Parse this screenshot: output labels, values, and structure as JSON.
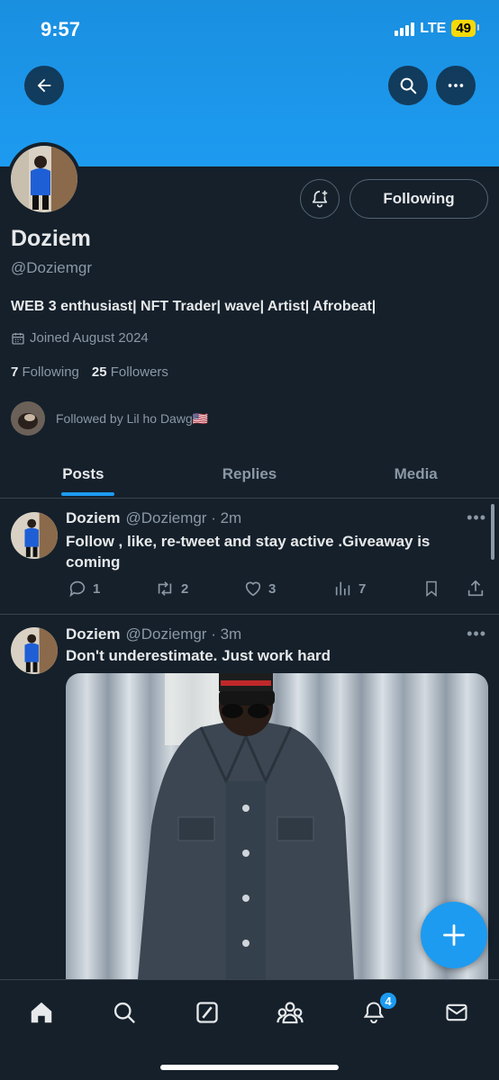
{
  "status_bar": {
    "time": "9:57",
    "network": "LTE",
    "battery": "49"
  },
  "header": {
    "back_icon": "arrow-left-icon",
    "search_icon": "search-icon",
    "more_icon": "more-horizontal-icon"
  },
  "profile": {
    "display_name": "Doziem",
    "handle": "@Doziemgr",
    "bio": "WEB 3 enthusiast| NFT Trader| wave| Artist| Afrobeat|",
    "joined": "Joined August 2024",
    "following_count": "7",
    "following_label": "Following",
    "followers_count": "25",
    "followers_label": "Followers",
    "followed_by": "Followed by Lil ho Dawg🇺🇸",
    "follow_button_label": "Following"
  },
  "tabs": [
    {
      "label": "Posts",
      "active": true
    },
    {
      "label": "Replies",
      "active": false
    },
    {
      "label": "Media",
      "active": false
    }
  ],
  "posts": [
    {
      "name": "Doziem",
      "meta": "@Doziemgr · 2m",
      "text": "Follow , like, re-tweet  and stay active .Giveaway is coming",
      "replies": "1",
      "reposts": "2",
      "likes": "3",
      "views": "7"
    },
    {
      "name": "Doziem",
      "meta": "@Doziemgr · 3m",
      "text": "Don't underestimate. Just work hard"
    }
  ],
  "notifications_badge": "4",
  "colors": {
    "accent": "#1d9bf0",
    "background": "#15202b",
    "muted": "#8b98a5"
  }
}
